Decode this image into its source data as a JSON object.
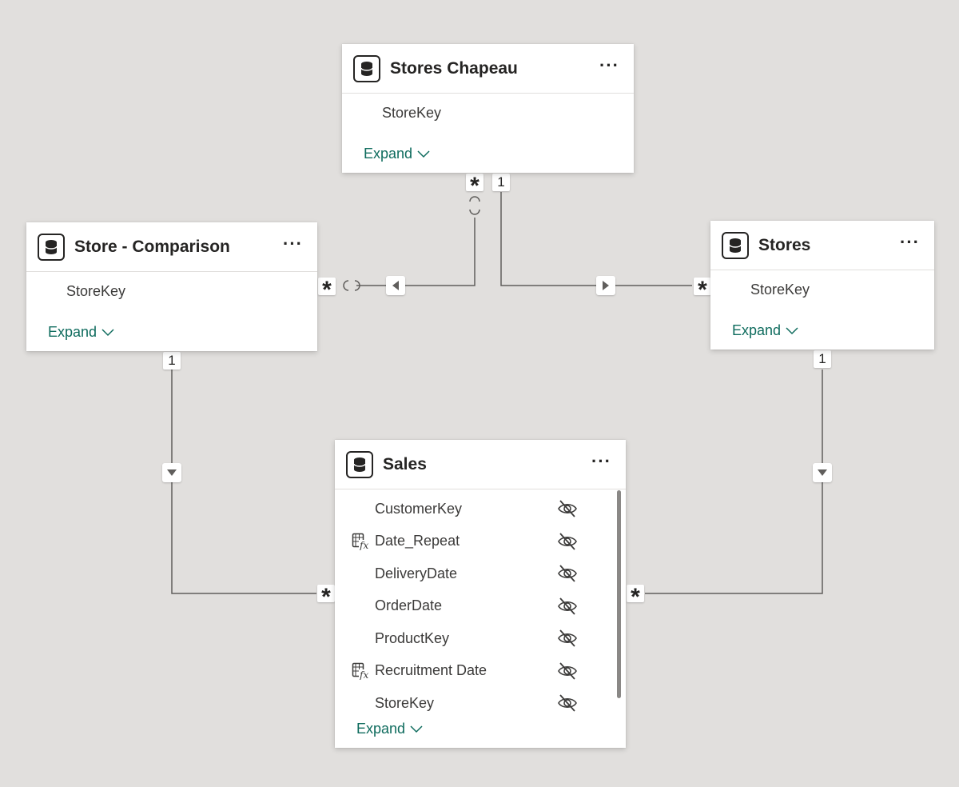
{
  "tables": {
    "stores_chapeau": {
      "title": "Stores Chapeau",
      "fields": [
        "StoreKey"
      ],
      "expand_label": "Expand"
    },
    "store_comparison": {
      "title": "Store - Comparison",
      "fields": [
        "StoreKey"
      ],
      "expand_label": "Expand"
    },
    "stores": {
      "title": "Stores",
      "fields": [
        "StoreKey"
      ],
      "expand_label": "Expand"
    },
    "sales": {
      "title": "Sales",
      "fields": [
        {
          "name": "CustomerKey",
          "calculated": false,
          "hidden": true
        },
        {
          "name": "Date_Repeat",
          "calculated": true,
          "hidden": true
        },
        {
          "name": "DeliveryDate",
          "calculated": false,
          "hidden": true
        },
        {
          "name": "OrderDate",
          "calculated": false,
          "hidden": true
        },
        {
          "name": "ProductKey",
          "calculated": false,
          "hidden": true
        },
        {
          "name": "Recruitment Date",
          "calculated": true,
          "hidden": true
        },
        {
          "name": "StoreKey",
          "calculated": false,
          "hidden": true
        }
      ],
      "expand_label": "Expand"
    }
  },
  "more_label": "···",
  "relationships": {
    "chapeau_many": "*",
    "chapeau_one": "1",
    "comparison_many": "*",
    "comparison_one": "1",
    "stores_many": "*",
    "stores_one": "1",
    "sales_left_many": "*",
    "sales_right_many": "*"
  },
  "icons": {
    "table": "database-icon",
    "more": "more-options-icon",
    "expand": "chevron-down-icon",
    "calculated": "calculated-column-icon",
    "hidden": "eye-hidden-icon",
    "filter_direction": "triangle-arrow-icon"
  },
  "colors": {
    "canvas": "#e1dfdd",
    "expand_link": "#0f6c5e",
    "line": "#605e5c"
  }
}
